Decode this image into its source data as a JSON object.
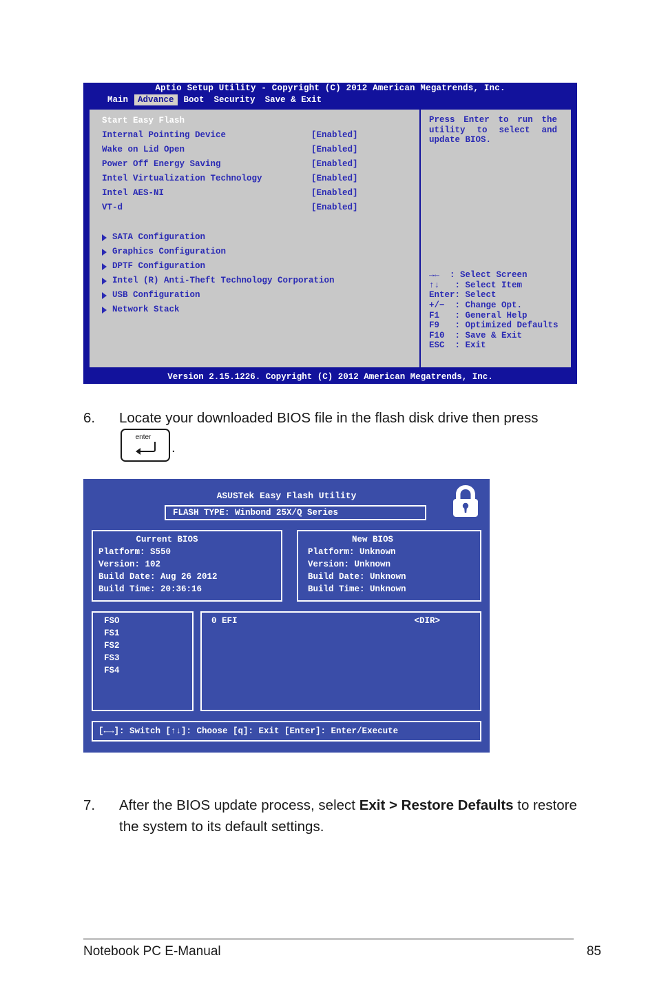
{
  "bios_screen": {
    "title": "Aptio Setup Utility - Copyright (C) 2012 American Megatrends, Inc.",
    "tabs": [
      {
        "label": "Main",
        "active": false
      },
      {
        "label": "Advance",
        "active": true
      },
      {
        "label": "Boot",
        "active": false
      },
      {
        "label": "Security",
        "active": false
      },
      {
        "label": "Save & Exit",
        "active": false
      }
    ],
    "items": [
      {
        "label": "Start Easy Flash",
        "value": "",
        "selected": true
      },
      {
        "label": "Internal Pointing Device",
        "value": "[Enabled]",
        "selected": false
      },
      {
        "label": "Wake on Lid Open",
        "value": "[Enabled]",
        "selected": false
      },
      {
        "label": "Power Off Energy Saving",
        "value": "[Enabled]",
        "selected": false
      },
      {
        "label": "Intel Virtualization Technology",
        "value": "[Enabled]",
        "selected": false
      },
      {
        "label": "Intel AES-NI",
        "value": "[Enabled]",
        "selected": false
      },
      {
        "label": "VT-d",
        "value": "[Enabled]",
        "selected": false
      }
    ],
    "submenus": [
      {
        "label": "SATA Configuration"
      },
      {
        "label": "Graphics Configuration"
      },
      {
        "label": "DPTF Configuration"
      },
      {
        "label": "Intel (R) Anti-Theft Technology Corporation"
      },
      {
        "label": "USB Configuration"
      },
      {
        "label": "Network Stack"
      }
    ],
    "help_text": "Press Enter to run the utility to select and update BIOS.",
    "key_legend": "→←  : Select Screen\n↑↓   : Select Item\nEnter: Select\n+/−  : Change Opt.\nF1   : General Help\nF9   : Optimized Defaults\nF10  : Save & Exit\nESC  : Exit",
    "footer": "Version 2.15.1226. Copyright (C) 2012 American Megatrends, Inc."
  },
  "step6": {
    "number": "6.",
    "text_before": "Locate your downloaded BIOS file in the flash disk drive then press",
    "key_label": "enter",
    "text_after": "."
  },
  "easy_flash": {
    "title": "ASUSTek Easy Flash Utility",
    "flash_type": "FLASH TYPE: Winbond 25X/Q Series",
    "current_bios": {
      "header": "Current BIOS",
      "platform": "Platform: S550",
      "version": "Version: 102",
      "build_date": "Build Date: Aug 26 2012",
      "build_time": "Build Time: 20:36:16"
    },
    "new_bios": {
      "header": "New BIOS",
      "platform": "Platform: Unknown",
      "version": "Version: Unknown",
      "build_date": "Build Date: Unknown",
      "build_time": "Build Time: Unknown"
    },
    "drives": [
      "FSO",
      "FS1",
      "FS2",
      "FS3",
      "FS4"
    ],
    "files": [
      {
        "name": "0 EFI",
        "size": "<DIR>"
      }
    ],
    "status_bar": "[←→]: Switch [↑↓]: Choose [q]: Exit [Enter]: Enter/Execute"
  },
  "step7": {
    "number": "7.",
    "text_before": "After the BIOS update process, select ",
    "bold": "Exit > Restore Defaults",
    "text_after": " to restore the system to its default settings."
  },
  "page_footer": {
    "left": "Notebook PC E-Manual",
    "page_number": "85"
  }
}
